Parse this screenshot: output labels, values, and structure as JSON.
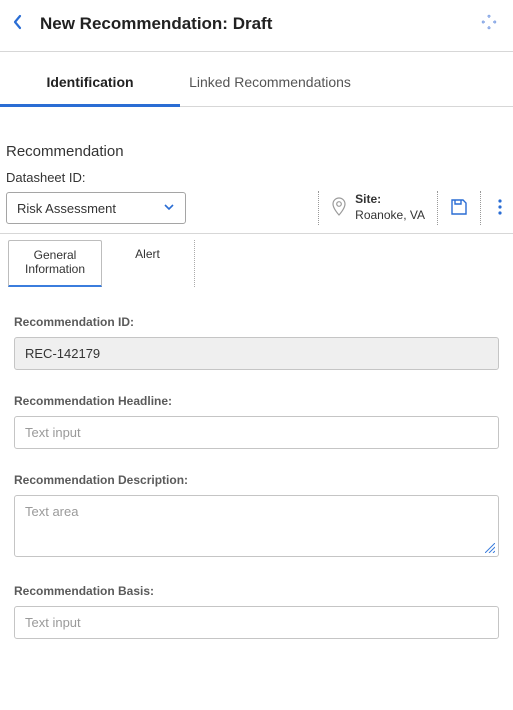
{
  "header": {
    "title": "New Recommendation: Draft"
  },
  "tabs": [
    {
      "label": "Identification",
      "active": true
    },
    {
      "label": "Linked Recommendations",
      "active": false
    }
  ],
  "section_title": "Recommendation",
  "datasheet": {
    "label": "Datasheet ID:",
    "value": "Risk Assessment"
  },
  "site": {
    "label": "Site:",
    "value": "Roanoke, VA"
  },
  "subtabs": [
    {
      "label": "General Information",
      "active": true
    },
    {
      "label": "Alert",
      "active": false
    }
  ],
  "fields": {
    "rec_id": {
      "label": "Recommendation ID:",
      "value": "REC-142179"
    },
    "headline": {
      "label": "Recommendation Headline:",
      "placeholder": "Text input",
      "value": ""
    },
    "description": {
      "label": "Recommendation Description:",
      "placeholder": "Text area",
      "value": ""
    },
    "basis": {
      "label": "Recommendation Basis:",
      "placeholder": "Text input",
      "value": ""
    }
  }
}
